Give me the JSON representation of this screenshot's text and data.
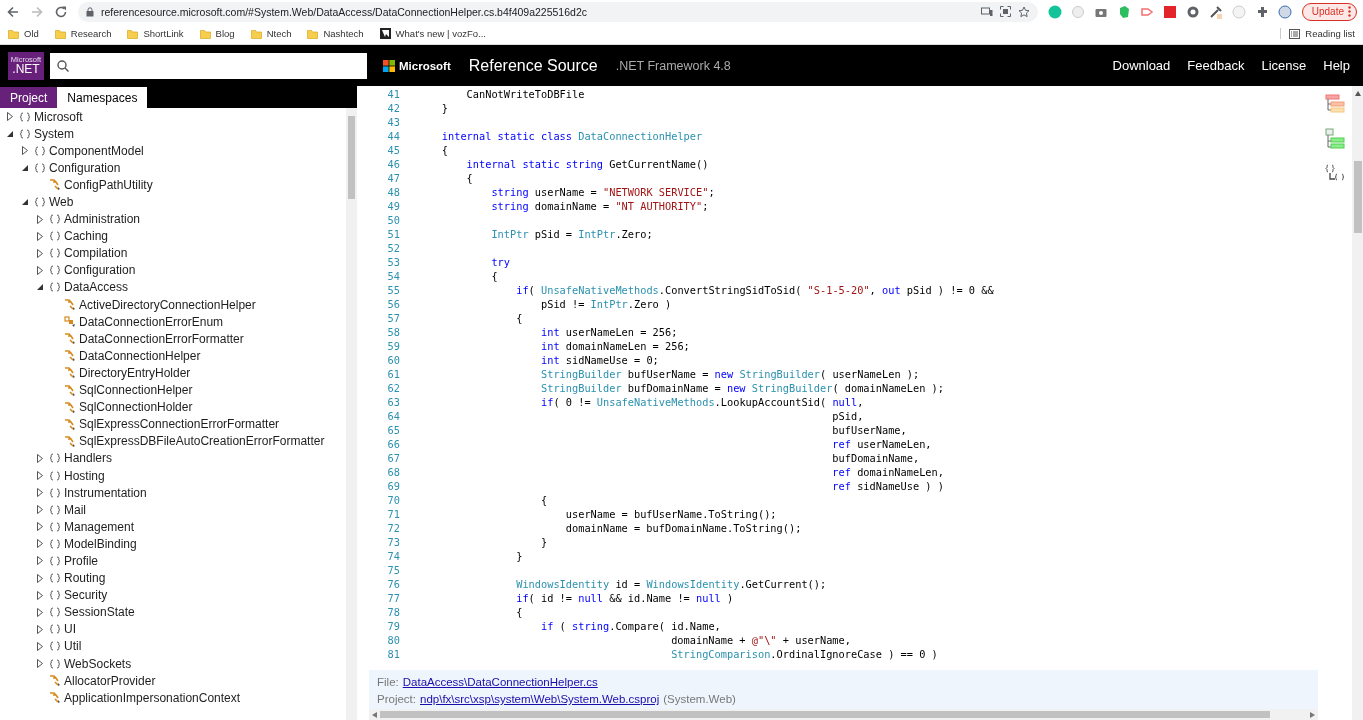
{
  "browser": {
    "url": "referencesource.microsoft.com/#System.Web/DataAccess/DataConnectionHelper.cs.b4f409a225516d2c",
    "update_button": "Update",
    "reading_list": "Reading list",
    "bookmarks": [
      {
        "label": "Old",
        "kind": "folder"
      },
      {
        "label": "Research",
        "kind": "folder"
      },
      {
        "label": "ShortLink",
        "kind": "folder"
      },
      {
        "label": "Blog",
        "kind": "folder"
      },
      {
        "label": "Ntech",
        "kind": "folder"
      },
      {
        "label": "Nashtech",
        "kind": "folder"
      },
      {
        "label": "What's new | vozFo...",
        "kind": "site"
      }
    ]
  },
  "header": {
    "logo_caption": "Microsoft",
    "logo": ".NET",
    "brand": "Microsoft",
    "title": "Reference Source",
    "subtitle": ".NET Framework 4.8",
    "nav": [
      "Download",
      "Feedback",
      "License",
      "Help"
    ]
  },
  "sidebar": {
    "tabs": [
      {
        "label": "Project",
        "selected": true
      },
      {
        "label": "Namespaces",
        "selected": false
      }
    ],
    "tree": [
      {
        "label": "Microsoft",
        "kind": "namespace",
        "expanded": false
      },
      {
        "label": "System",
        "kind": "namespace",
        "expanded": true,
        "children": [
          {
            "label": "ComponentModel",
            "kind": "namespace",
            "expanded": false
          },
          {
            "label": "Configuration",
            "kind": "namespace",
            "expanded": true,
            "children": [
              {
                "label": "ConfigPathUtility",
                "kind": "class"
              }
            ]
          },
          {
            "label": "Web",
            "kind": "namespace",
            "expanded": true,
            "children": [
              {
                "label": "Administration",
                "kind": "namespace",
                "expanded": false
              },
              {
                "label": "Caching",
                "kind": "namespace",
                "expanded": false
              },
              {
                "label": "Compilation",
                "kind": "namespace",
                "expanded": false
              },
              {
                "label": "Configuration",
                "kind": "namespace",
                "expanded": false
              },
              {
                "label": "DataAccess",
                "kind": "namespace",
                "expanded": true,
                "children": [
                  {
                    "label": "ActiveDirectoryConnectionHelper",
                    "kind": "class"
                  },
                  {
                    "label": "DataConnectionErrorEnum",
                    "kind": "enum"
                  },
                  {
                    "label": "DataConnectionErrorFormatter",
                    "kind": "class"
                  },
                  {
                    "label": "DataConnectionHelper",
                    "kind": "class"
                  },
                  {
                    "label": "DirectoryEntryHolder",
                    "kind": "class"
                  },
                  {
                    "label": "SqlConnectionHelper",
                    "kind": "class"
                  },
                  {
                    "label": "SqlConnectionHolder",
                    "kind": "class"
                  },
                  {
                    "label": "SqlExpressConnectionErrorFormatter",
                    "kind": "class"
                  },
                  {
                    "label": "SqlExpressDBFileAutoCreationErrorFormatter",
                    "kind": "class"
                  }
                ]
              },
              {
                "label": "Handlers",
                "kind": "namespace",
                "expanded": false
              },
              {
                "label": "Hosting",
                "kind": "namespace",
                "expanded": false
              },
              {
                "label": "Instrumentation",
                "kind": "namespace",
                "expanded": false
              },
              {
                "label": "Mail",
                "kind": "namespace",
                "expanded": false
              },
              {
                "label": "Management",
                "kind": "namespace",
                "expanded": false
              },
              {
                "label": "ModelBinding",
                "kind": "namespace",
                "expanded": false
              },
              {
                "label": "Profile",
                "kind": "namespace",
                "expanded": false
              },
              {
                "label": "Routing",
                "kind": "namespace",
                "expanded": false
              },
              {
                "label": "Security",
                "kind": "namespace",
                "expanded": false
              },
              {
                "label": "SessionState",
                "kind": "namespace",
                "expanded": false
              },
              {
                "label": "UI",
                "kind": "namespace",
                "expanded": false
              },
              {
                "label": "Util",
                "kind": "namespace",
                "expanded": false
              },
              {
                "label": "WebSockets",
                "kind": "namespace",
                "expanded": false
              },
              {
                "label": "AllocatorProvider",
                "kind": "class"
              },
              {
                "label": "ApplicationImpersonationContext",
                "kind": "class"
              }
            ]
          }
        ]
      }
    ]
  },
  "code": {
    "lines": [
      {
        "n": "41",
        "tokens": [
          {
            "kind": "plain",
            "t": "        CanNotWriteToDBFile"
          }
        ]
      },
      {
        "n": "42",
        "tokens": [
          {
            "kind": "plain",
            "t": "    }"
          }
        ]
      },
      {
        "n": "43"
      },
      {
        "n": "44",
        "tokens": [
          {
            "kind": "keyword",
            "t": "    internal static class "
          },
          {
            "kind": "type",
            "t": "DataConnectionHelper"
          }
        ]
      },
      {
        "n": "45",
        "tokens": [
          {
            "kind": "plain",
            "t": "    {"
          }
        ]
      },
      {
        "n": "46",
        "tokens": [
          {
            "kind": "keyword",
            "t": "        internal static string"
          },
          {
            "kind": "plain",
            "t": " GetCurrentName()"
          }
        ]
      },
      {
        "n": "47",
        "tokens": [
          {
            "kind": "plain",
            "t": "        {"
          }
        ]
      },
      {
        "n": "48",
        "tokens": [
          {
            "kind": "keyword",
            "t": "            string"
          },
          {
            "kind": "plain",
            "t": " userName = "
          },
          {
            "kind": "string",
            "t": "\"NETWORK SERVICE\""
          },
          {
            "kind": "plain",
            "t": ";"
          }
        ]
      },
      {
        "n": "49",
        "tokens": [
          {
            "kind": "keyword",
            "t": "            string"
          },
          {
            "kind": "plain",
            "t": " domainName = "
          },
          {
            "kind": "string",
            "t": "\"NT AUTHORITY\""
          },
          {
            "kind": "plain",
            "t": ";"
          }
        ]
      },
      {
        "n": "50"
      },
      {
        "n": "51",
        "tokens": [
          {
            "kind": "type",
            "t": "            IntPtr"
          },
          {
            "kind": "plain",
            "t": " pSid = "
          },
          {
            "kind": "type",
            "t": "IntPtr"
          },
          {
            "kind": "plain",
            "t": ".Zero;"
          }
        ]
      },
      {
        "n": "52"
      },
      {
        "n": "53",
        "tokens": [
          {
            "kind": "keyword",
            "t": "            try"
          }
        ]
      },
      {
        "n": "54",
        "tokens": [
          {
            "kind": "plain",
            "t": "            {"
          }
        ]
      },
      {
        "n": "55",
        "tokens": [
          {
            "kind": "keyword",
            "t": "                if"
          },
          {
            "kind": "plain",
            "t": "( "
          },
          {
            "kind": "type",
            "t": "UnsafeNativeMethods"
          },
          {
            "kind": "plain",
            "t": ".ConvertStringSidToSid( "
          },
          {
            "kind": "string",
            "t": "\"S-1-5-20\""
          },
          {
            "kind": "plain",
            "t": ", "
          },
          {
            "kind": "keyword",
            "t": "out"
          },
          {
            "kind": "plain",
            "t": " pSid ) != 0 &&"
          }
        ]
      },
      {
        "n": "56",
        "tokens": [
          {
            "kind": "plain",
            "t": "                    pSid != "
          },
          {
            "kind": "type",
            "t": "IntPtr"
          },
          {
            "kind": "plain",
            "t": ".Zero )"
          }
        ]
      },
      {
        "n": "57",
        "tokens": [
          {
            "kind": "plain",
            "t": "                {"
          }
        ]
      },
      {
        "n": "58",
        "tokens": [
          {
            "kind": "keyword",
            "t": "                    int"
          },
          {
            "kind": "plain",
            "t": " userNameLen = 256;"
          }
        ]
      },
      {
        "n": "59",
        "tokens": [
          {
            "kind": "keyword",
            "t": "                    int"
          },
          {
            "kind": "plain",
            "t": " domainNameLen = 256;"
          }
        ]
      },
      {
        "n": "60",
        "tokens": [
          {
            "kind": "keyword",
            "t": "                    int"
          },
          {
            "kind": "plain",
            "t": " sidNameUse = 0;"
          }
        ]
      },
      {
        "n": "61",
        "tokens": [
          {
            "kind": "type",
            "t": "                    StringBuilder"
          },
          {
            "kind": "plain",
            "t": " bufUserName = "
          },
          {
            "kind": "keyword",
            "t": "new "
          },
          {
            "kind": "type",
            "t": "StringBuilder"
          },
          {
            "kind": "plain",
            "t": "( userNameLen );"
          }
        ]
      },
      {
        "n": "62",
        "tokens": [
          {
            "kind": "type",
            "t": "                    StringBuilder"
          },
          {
            "kind": "plain",
            "t": " bufDomainName = "
          },
          {
            "kind": "keyword",
            "t": "new "
          },
          {
            "kind": "type",
            "t": "StringBuilder"
          },
          {
            "kind": "plain",
            "t": "( domainNameLen );"
          }
        ]
      },
      {
        "n": "63",
        "tokens": [
          {
            "kind": "keyword",
            "t": "                    if"
          },
          {
            "kind": "plain",
            "t": "( 0 != "
          },
          {
            "kind": "type",
            "t": "UnsafeNativeMethods"
          },
          {
            "kind": "plain",
            "t": ".LookupAccountSid( "
          },
          {
            "kind": "keyword",
            "t": "null"
          },
          {
            "kind": "plain",
            "t": ","
          }
        ]
      },
      {
        "n": "64",
        "tokens": [
          {
            "kind": "plain",
            "t": "                                                                   pSid,"
          }
        ]
      },
      {
        "n": "65",
        "tokens": [
          {
            "kind": "plain",
            "t": "                                                                   bufUserName,"
          }
        ]
      },
      {
        "n": "66",
        "tokens": [
          {
            "kind": "keyword",
            "t": "                                                                   ref"
          },
          {
            "kind": "plain",
            "t": " userNameLen,"
          }
        ]
      },
      {
        "n": "67",
        "tokens": [
          {
            "kind": "plain",
            "t": "                                                                   bufDomainName,"
          }
        ]
      },
      {
        "n": "68",
        "tokens": [
          {
            "kind": "keyword",
            "t": "                                                                   ref"
          },
          {
            "kind": "plain",
            "t": " domainNameLen,"
          }
        ]
      },
      {
        "n": "69",
        "tokens": [
          {
            "kind": "keyword",
            "t": "                                                                   ref"
          },
          {
            "kind": "plain",
            "t": " sidNameUse ) )"
          }
        ]
      },
      {
        "n": "70",
        "tokens": [
          {
            "kind": "plain",
            "t": "                    {"
          }
        ]
      },
      {
        "n": "71",
        "tokens": [
          {
            "kind": "plain",
            "t": "                        userName = bufUserName.ToString();"
          }
        ]
      },
      {
        "n": "72",
        "tokens": [
          {
            "kind": "plain",
            "t": "                        domainName = bufDomainName.ToString();"
          }
        ]
      },
      {
        "n": "73",
        "tokens": [
          {
            "kind": "plain",
            "t": "                    }"
          }
        ]
      },
      {
        "n": "74",
        "tokens": [
          {
            "kind": "plain",
            "t": "                }"
          }
        ]
      },
      {
        "n": "75"
      },
      {
        "n": "76",
        "tokens": [
          {
            "kind": "type",
            "t": "                WindowsIdentity"
          },
          {
            "kind": "plain",
            "t": " id = "
          },
          {
            "kind": "type",
            "t": "WindowsIdentity"
          },
          {
            "kind": "plain",
            "t": ".GetCurrent();"
          }
        ]
      },
      {
        "n": "77",
        "tokens": [
          {
            "kind": "keyword",
            "t": "                if"
          },
          {
            "kind": "plain",
            "t": "( id != "
          },
          {
            "kind": "keyword",
            "t": "null"
          },
          {
            "kind": "plain",
            "t": " && id.Name != "
          },
          {
            "kind": "keyword",
            "t": "null"
          },
          {
            "kind": "plain",
            "t": " )"
          }
        ]
      },
      {
        "n": "78",
        "tokens": [
          {
            "kind": "plain",
            "t": "                {"
          }
        ]
      },
      {
        "n": "79",
        "tokens": [
          {
            "kind": "keyword",
            "t": "                    if"
          },
          {
            "kind": "plain",
            "t": " ( "
          },
          {
            "kind": "keyword",
            "t": "string"
          },
          {
            "kind": "plain",
            "t": ".Compare( id.Name,"
          }
        ]
      },
      {
        "n": "80",
        "tokens": [
          {
            "kind": "plain",
            "t": "                                         domainName + "
          },
          {
            "kind": "string",
            "t": "@\"\\\""
          },
          {
            "kind": "plain",
            "t": " + userName,"
          }
        ]
      },
      {
        "n": "81",
        "tokens": [
          {
            "kind": "type",
            "t": "                                         StringComparison"
          },
          {
            "kind": "plain",
            "t": ".OrdinalIgnoreCase ) == 0 )"
          }
        ]
      }
    ]
  },
  "footer": {
    "file_label": "File:",
    "file_link": "DataAccess\\DataConnectionHelper.cs",
    "project_label": "Project:",
    "project_link": "ndp\\fx\\src\\xsp\\system\\Web\\System.Web.csproj",
    "project_name": "(System.Web)"
  }
}
